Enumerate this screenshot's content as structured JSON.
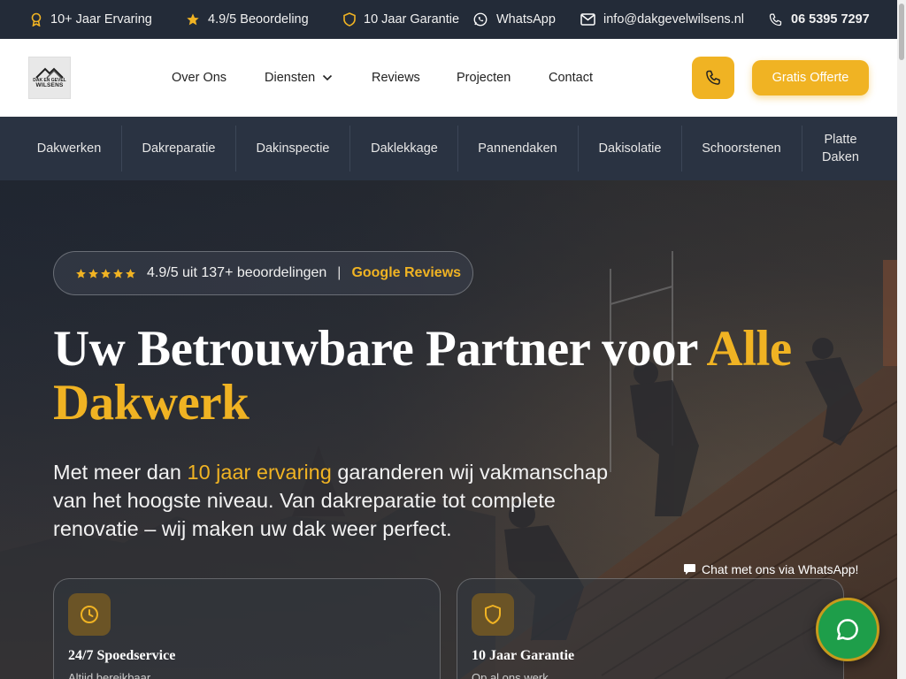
{
  "topbar": {
    "experience": "10+ Jaar Ervaring",
    "rating": "4.9/5 Beoordeling",
    "guarantee": "10 Jaar Garantie",
    "whatsapp": "WhatsApp",
    "email": "info@dakgevelwilsens.nl",
    "phone": "06 5395 7297"
  },
  "logo": {
    "line1": "DAK EN GEVEL",
    "line2": "WILSENS"
  },
  "nav": {
    "items": [
      "Over Ons",
      "Diensten",
      "Reviews",
      "Projecten",
      "Contact"
    ],
    "cta": "Gratis Offerte"
  },
  "services": [
    "Dakwerken",
    "Dakreparatie",
    "Dakinspectie",
    "Daklekkage",
    "Pannendaken",
    "Dakisolatie",
    "Schoorstenen",
    "Platte Daken"
  ],
  "hero": {
    "badge_text": "4.9/5 uit 137+ beoordelingen",
    "badge_sep": "|",
    "badge_link": "Google Reviews",
    "title_part1": "Uw Betrouwbare Partner voor ",
    "title_accent": "Alle Dakwerk",
    "sub_part1": "Met meer dan ",
    "sub_accent": "10 jaar ervaring",
    "sub_part2": " garanderen wij vakmanschap van het hoogste niveau. Van dakreparatie tot complete renovatie – wij maken uw dak weer perfect."
  },
  "cards": [
    {
      "title": "24/7 Spoedservice",
      "desc": "Altijd bereikbaar"
    },
    {
      "title": "10 Jaar Garantie",
      "desc": "Op al ons werk"
    }
  ],
  "chat": {
    "label": "Chat met ons via WhatsApp!"
  },
  "colors": {
    "accent": "#f0b323",
    "dark": "#232b38",
    "whatsapp": "#1e9e4a"
  }
}
